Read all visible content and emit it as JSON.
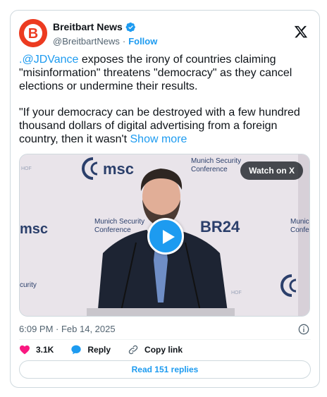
{
  "author": {
    "name": "Breitbart News",
    "handle": "@BreitbartNews",
    "separator": "·",
    "follow_label": "Follow",
    "logo_letter": "B",
    "brand_color": "#ec3b20"
  },
  "tweet": {
    "paragraph1_mention": ".@JDVance",
    "paragraph1_rest": " exposes the irony of countries claiming \"misinformation\" threatens \"democracy\" as they cancel elections or undermine their results.",
    "paragraph2": "\"If your democracy can be destroyed with a few hundred thousand dollars of digital advertising from a foreign country, then it wasn't ",
    "show_more": "Show more"
  },
  "media": {
    "watch_label": "Watch on X",
    "backdrop": {
      "msc_top": "msc",
      "conf_top_line1": "Munich Security",
      "conf_top_line2": "Conference",
      "conf_mid_line1": "Munich Security",
      "conf_mid_line2": "Conference",
      "conf_right_line1": "Munich Se",
      "conf_right_line2": "Conferen",
      "msc_left": "msc",
      "curity_left": "curity",
      "br24": "BR24",
      "hof_top": "HOF",
      "hof_bottom": "HOF"
    }
  },
  "meta": {
    "timestamp": "6:09 PM · Feb 14, 2025"
  },
  "actions": {
    "likes": "3.1K",
    "reply_label": "Reply",
    "copy_link_label": "Copy link"
  },
  "replies_button": "Read 151 replies",
  "colors": {
    "accent": "#1d9bf0",
    "like": "#f91880",
    "text": "#0f1419",
    "secondary": "#536471"
  }
}
